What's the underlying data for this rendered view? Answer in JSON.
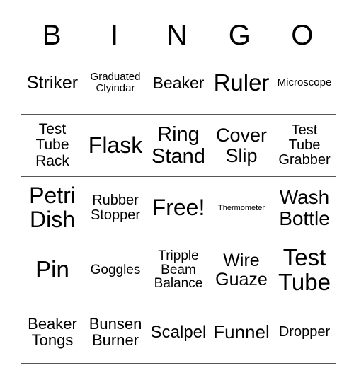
{
  "header": {
    "letters": [
      "B",
      "I",
      "N",
      "G",
      "O"
    ]
  },
  "board": {
    "rows": [
      [
        {
          "text": "Striker",
          "size": 25
        },
        {
          "text": "Graduated\nClyindar",
          "size": 15
        },
        {
          "text": "Beaker",
          "size": 23
        },
        {
          "text": "Ruler",
          "size": 33
        },
        {
          "text": "Microscope",
          "size": 15
        }
      ],
      [
        {
          "text": "Test\nTube\nRack",
          "size": 21
        },
        {
          "text": "Flask",
          "size": 32
        },
        {
          "text": "Ring\nStand",
          "size": 29
        },
        {
          "text": "Cover\nSlip",
          "size": 27
        },
        {
          "text": "Test\nTube\nGrabber",
          "size": 20
        }
      ],
      [
        {
          "text": "Petri\nDish",
          "size": 32
        },
        {
          "text": "Rubber\nStopper",
          "size": 20
        },
        {
          "text": "Free!",
          "size": 32
        },
        {
          "text": "Thermometer",
          "size": 11
        },
        {
          "text": "Wash\nBottle",
          "size": 28
        }
      ],
      [
        {
          "text": "Pin",
          "size": 33
        },
        {
          "text": "Goggles",
          "size": 19
        },
        {
          "text": "Tripple\nBeam\nBalance",
          "size": 19
        },
        {
          "text": "Wire\nGuaze",
          "size": 25
        },
        {
          "text": "Test\nTube",
          "size": 33
        }
      ],
      [
        {
          "text": "Beaker\nTongs",
          "size": 22
        },
        {
          "text": "Bunsen\nBurner",
          "size": 22
        },
        {
          "text": "Scalpel",
          "size": 24
        },
        {
          "text": "Funnel",
          "size": 26
        },
        {
          "text": "Dropper",
          "size": 20
        }
      ]
    ]
  }
}
